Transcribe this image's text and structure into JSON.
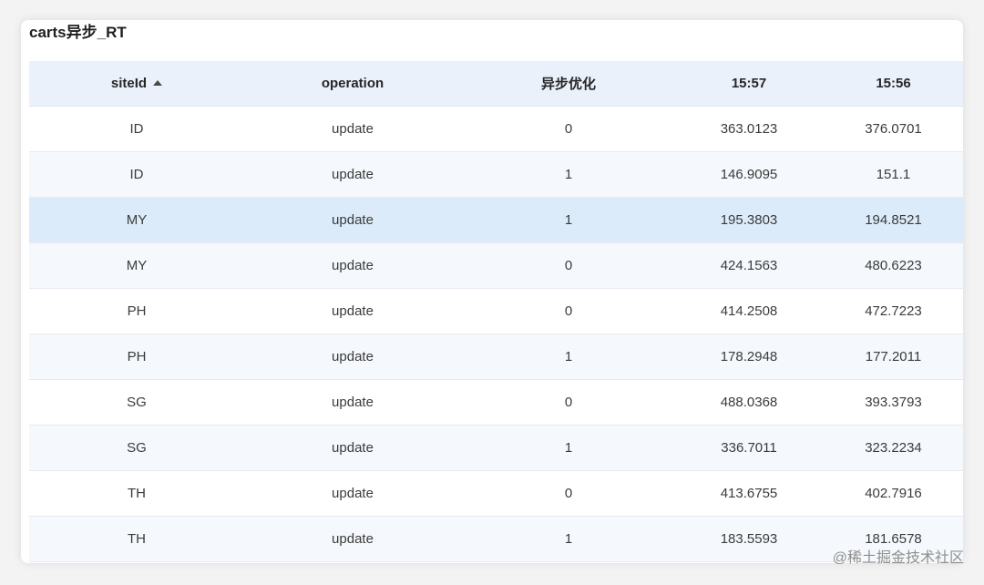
{
  "panel": {
    "title": "carts异步_RT"
  },
  "table": {
    "columns": [
      "siteId",
      "operation",
      "异步优化",
      "15:57",
      "15:56"
    ],
    "rows": [
      [
        "ID",
        "update",
        "0",
        "363.0123",
        "376.0701"
      ],
      [
        "ID",
        "update",
        "1",
        "146.9095",
        "151.1"
      ],
      [
        "MY",
        "update",
        "1",
        "195.3803",
        "194.8521"
      ],
      [
        "MY",
        "update",
        "0",
        "424.1563",
        "480.6223"
      ],
      [
        "PH",
        "update",
        "0",
        "414.2508",
        "472.7223"
      ],
      [
        "PH",
        "update",
        "1",
        "178.2948",
        "177.2011"
      ],
      [
        "SG",
        "update",
        "0",
        "488.0368",
        "393.3793"
      ],
      [
        "SG",
        "update",
        "1",
        "336.7011",
        "323.2234"
      ],
      [
        "TH",
        "update",
        "0",
        "413.6755",
        "402.7916"
      ],
      [
        "TH",
        "update",
        "1",
        "183.5593",
        "181.6578"
      ]
    ],
    "sort_column": "siteId",
    "sort_icon": "sort-ascending-icon",
    "selected_row": 2
  },
  "credit": {
    "text": "@稀土掘金技术社区"
  },
  "colors": {
    "header_bg": "#ebf1fb",
    "selected_row_bg": "#dcebfa",
    "stripe_bg": "#f5f8fc"
  }
}
